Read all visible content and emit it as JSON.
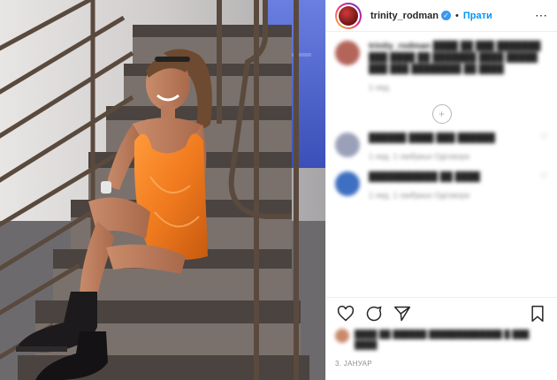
{
  "post": {
    "username": "trinity_rodman",
    "follow_label": "Прати",
    "date": "3. ЈАНУАР",
    "more_icon": "ellipsis-icon",
    "verified_icon": "verified-badge-icon"
  },
  "comments": [
    {
      "user": "trinity_rodman",
      "text": "████ ██ ███ ███████ ███ ████ ██ ███████ ████ █████ ███ ███ ████████ ██ ████",
      "meta": "1 нед."
    },
    {
      "user": "██████",
      "text": "████ ███ ██████",
      "meta": "1 нед.   1 свиђање   Одговори"
    },
    {
      "user": "███████████",
      "text": "██ ████",
      "meta": "1 нед.   1 свиђање   Одговори"
    }
  ],
  "actions": {
    "like_icon": "heart-icon",
    "comment_icon": "comment-icon",
    "share_icon": "share-icon",
    "save_icon": "bookmark-icon"
  },
  "likes_text": "████ ██ ██████ █████████████ █ ███ ████",
  "colors": {
    "accent": "#0095f6",
    "verified": "#3897f0",
    "dress": "#f07a1e"
  }
}
